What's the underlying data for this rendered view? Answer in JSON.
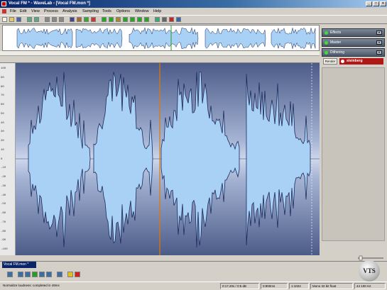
{
  "window": {
    "title": "Vocal FM * - WaveLab - [Vocal FM.mon *]",
    "minimize_glyph": "_",
    "maximize_glyph": "□",
    "close_glyph": "×"
  },
  "menu": {
    "items": [
      "File",
      "Edit",
      "View",
      "Process",
      "Analysis",
      "Sampling",
      "Tools",
      "Options",
      "Window",
      "Help"
    ]
  },
  "toolbar": {
    "icons": [
      "new-icon",
      "open-icon",
      "save-icon",
      "sep",
      "undo-icon",
      "redo-icon",
      "sep",
      "cut-icon",
      "copy-icon",
      "paste-icon",
      "sep",
      "zoom-icon",
      "pencil-icon",
      "play-tool-icon",
      "marker-icon",
      "sep",
      "meter1-icon",
      "meter2-icon",
      "meter3-icon",
      "meter4-icon",
      "meter5-icon",
      "meter6-icon",
      "meter7-icon",
      "sep",
      "loop-icon",
      "settings-icon",
      "record-icon",
      "help-icon"
    ]
  },
  "master_section": {
    "plugins": [
      {
        "label": "Effects",
        "button": "▾"
      },
      {
        "label": "Master",
        "button": "▾"
      },
      {
        "label": "Dithering",
        "button": "▾"
      }
    ],
    "render_label": "Render",
    "brand_label": "steinberg"
  },
  "level_scale": [
    "100",
    "90",
    "80",
    "70",
    "60",
    "50",
    "40",
    "30",
    "20",
    "10",
    "0",
    "-10",
    "-20",
    "-30",
    "-40",
    "-50",
    "-60",
    "-70",
    "-80",
    "-90",
    "-100"
  ],
  "document_tab": "Vocal FM.mon *",
  "transport": {
    "buttons": [
      "stop-icon",
      "rewind-start-icon",
      "rewind-icon",
      "play-icon",
      "fast-forward-icon",
      "go-end-icon",
      "loop-icon",
      "pause-icon",
      "record-icon"
    ]
  },
  "status": {
    "message": "Normalize loudness: completed in 49ms",
    "position": "0:17.20s / 0:5 dB",
    "selection": "0:800ms",
    "zoom": "1:1024",
    "format": "Mono 32 bit float",
    "rate": "44 100 Hz"
  },
  "watermark": "VTS",
  "colors": {
    "wave_fill": "#a9d0f5",
    "wave_stroke": "#1d2a5a",
    "background_dark": "#4c5c88",
    "cursor": "#e07a00",
    "brand": "#b01818"
  }
}
